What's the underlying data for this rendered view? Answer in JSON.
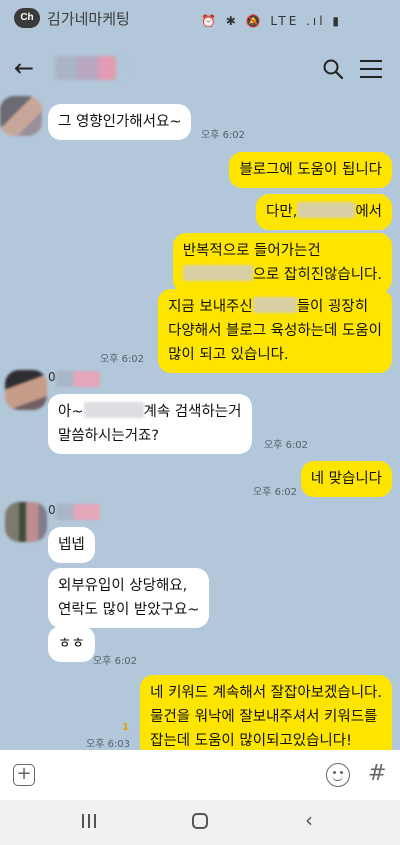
{
  "status_bar": {
    "app_name": "김가네마케팅",
    "badge": "Ch",
    "icons": "⏰ ✱ 🔕 LTE .ıl ▮"
  },
  "header": {
    "back_icon": "back-arrow-icon",
    "search_icon": "search-icon",
    "menu_icon": "menu-icon"
  },
  "messages": [
    {
      "side": "in",
      "text": "그 영향인가해서요~",
      "time": "오후 6:02"
    },
    {
      "side": "out",
      "text": "블로그에 도움이 됩니다"
    },
    {
      "side": "out",
      "text_before": "다만,",
      "text_after": "에서"
    },
    {
      "side": "out",
      "line1": "반복적으로 들어가는건",
      "line2_after": "으로 잡히진않습니다."
    },
    {
      "side": "out",
      "line1_before": "지금 보내주신",
      "line1_after": "들이 굉장히",
      "line2": "다양해서 블로그 육성하는데 도움이",
      "line3": "많이 되고 있습니다.",
      "time": "오후 6:02"
    },
    {
      "side": "in",
      "line1_before": "아~",
      "line1_after": "계속 검색하는거",
      "line2": "말씀하시는거죠?",
      "time": "오후 6:02"
    },
    {
      "side": "out",
      "text": "네 맞습니다",
      "time": "오후 6:02"
    },
    {
      "side": "in",
      "text": "넵넵"
    },
    {
      "side": "in",
      "line1": "외부유입이 상당해요,",
      "line2": "연락도 많이 받았구요~"
    },
    {
      "side": "in",
      "text": "ㅎㅎ",
      "time": "오후 6:02"
    },
    {
      "side": "out",
      "line1": "네 키워드 계속해서 잘잡아보겠습니다.",
      "line2": "물건을 워낙에 잘보내주셔서 키워드를",
      "line3": "잡는데 도움이 많이되고있습니다!",
      "time": "오후 6:03",
      "unread": "1"
    }
  ],
  "sender_prefix": "0",
  "input_bar": {
    "plus": "+",
    "emoji_icon": "emoji-icon",
    "hash": "#"
  },
  "nav": {
    "recent_icon": "recent-apps-icon",
    "home_icon": "home-icon",
    "back": "‹"
  }
}
